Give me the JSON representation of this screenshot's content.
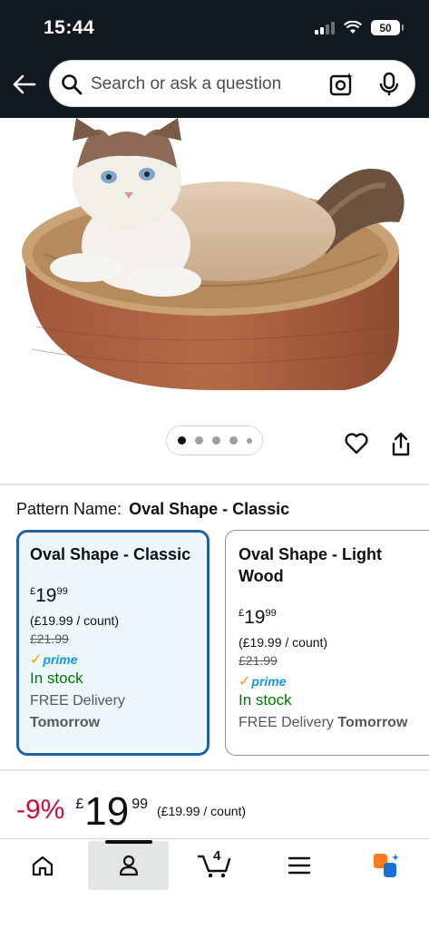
{
  "status_bar": {
    "time": "15:44",
    "battery": "50"
  },
  "search": {
    "placeholder": "Search or ask a question"
  },
  "product": {
    "pattern_label": "Pattern Name:",
    "pattern_value": "Oval Shape - Classic",
    "carousel": {
      "total": 5,
      "active": 1
    }
  },
  "options": [
    {
      "title": "Oval Shape - Classic",
      "price_currency": "£",
      "price_whole": "19",
      "price_fraction": "99",
      "unit_price": "(£19.99 / count)",
      "was_price": "£21.99",
      "prime": "prime",
      "stock": "In stock",
      "delivery_prefix": "FREE Delivery",
      "delivery_day": "Tomorrow",
      "selected": true
    },
    {
      "title": "Oval Shape - Light Wood",
      "price_currency": "£",
      "price_whole": "19",
      "price_fraction": "99",
      "unit_price": "(£19.99 / count)",
      "was_price": "£21.99",
      "prime": "prime",
      "stock": "In stock",
      "delivery_prefix": "FREE Delivery",
      "delivery_day": "Tomorrow",
      "selected": false
    }
  ],
  "price": {
    "discount": "-9%",
    "currency": "£",
    "whole": "19",
    "fraction": "99",
    "unit_price": "(£19.99 / count)"
  },
  "bottom_nav": {
    "cart_count": "4"
  },
  "colors": {
    "header_bg": "#131921",
    "selected_border": "#2162a1",
    "selected_bg": "#edf8fd",
    "discount": "#cc0c39",
    "in_stock": "#007600",
    "prime_blue": "#1399d6",
    "prime_check": "#ff9900"
  },
  "icons": [
    "back-arrow-icon",
    "search-icon",
    "camera-search-icon",
    "microphone-icon",
    "heart-icon",
    "share-icon",
    "home-icon",
    "person-icon",
    "cart-icon",
    "menu-icon",
    "rufus-ai-icon"
  ]
}
